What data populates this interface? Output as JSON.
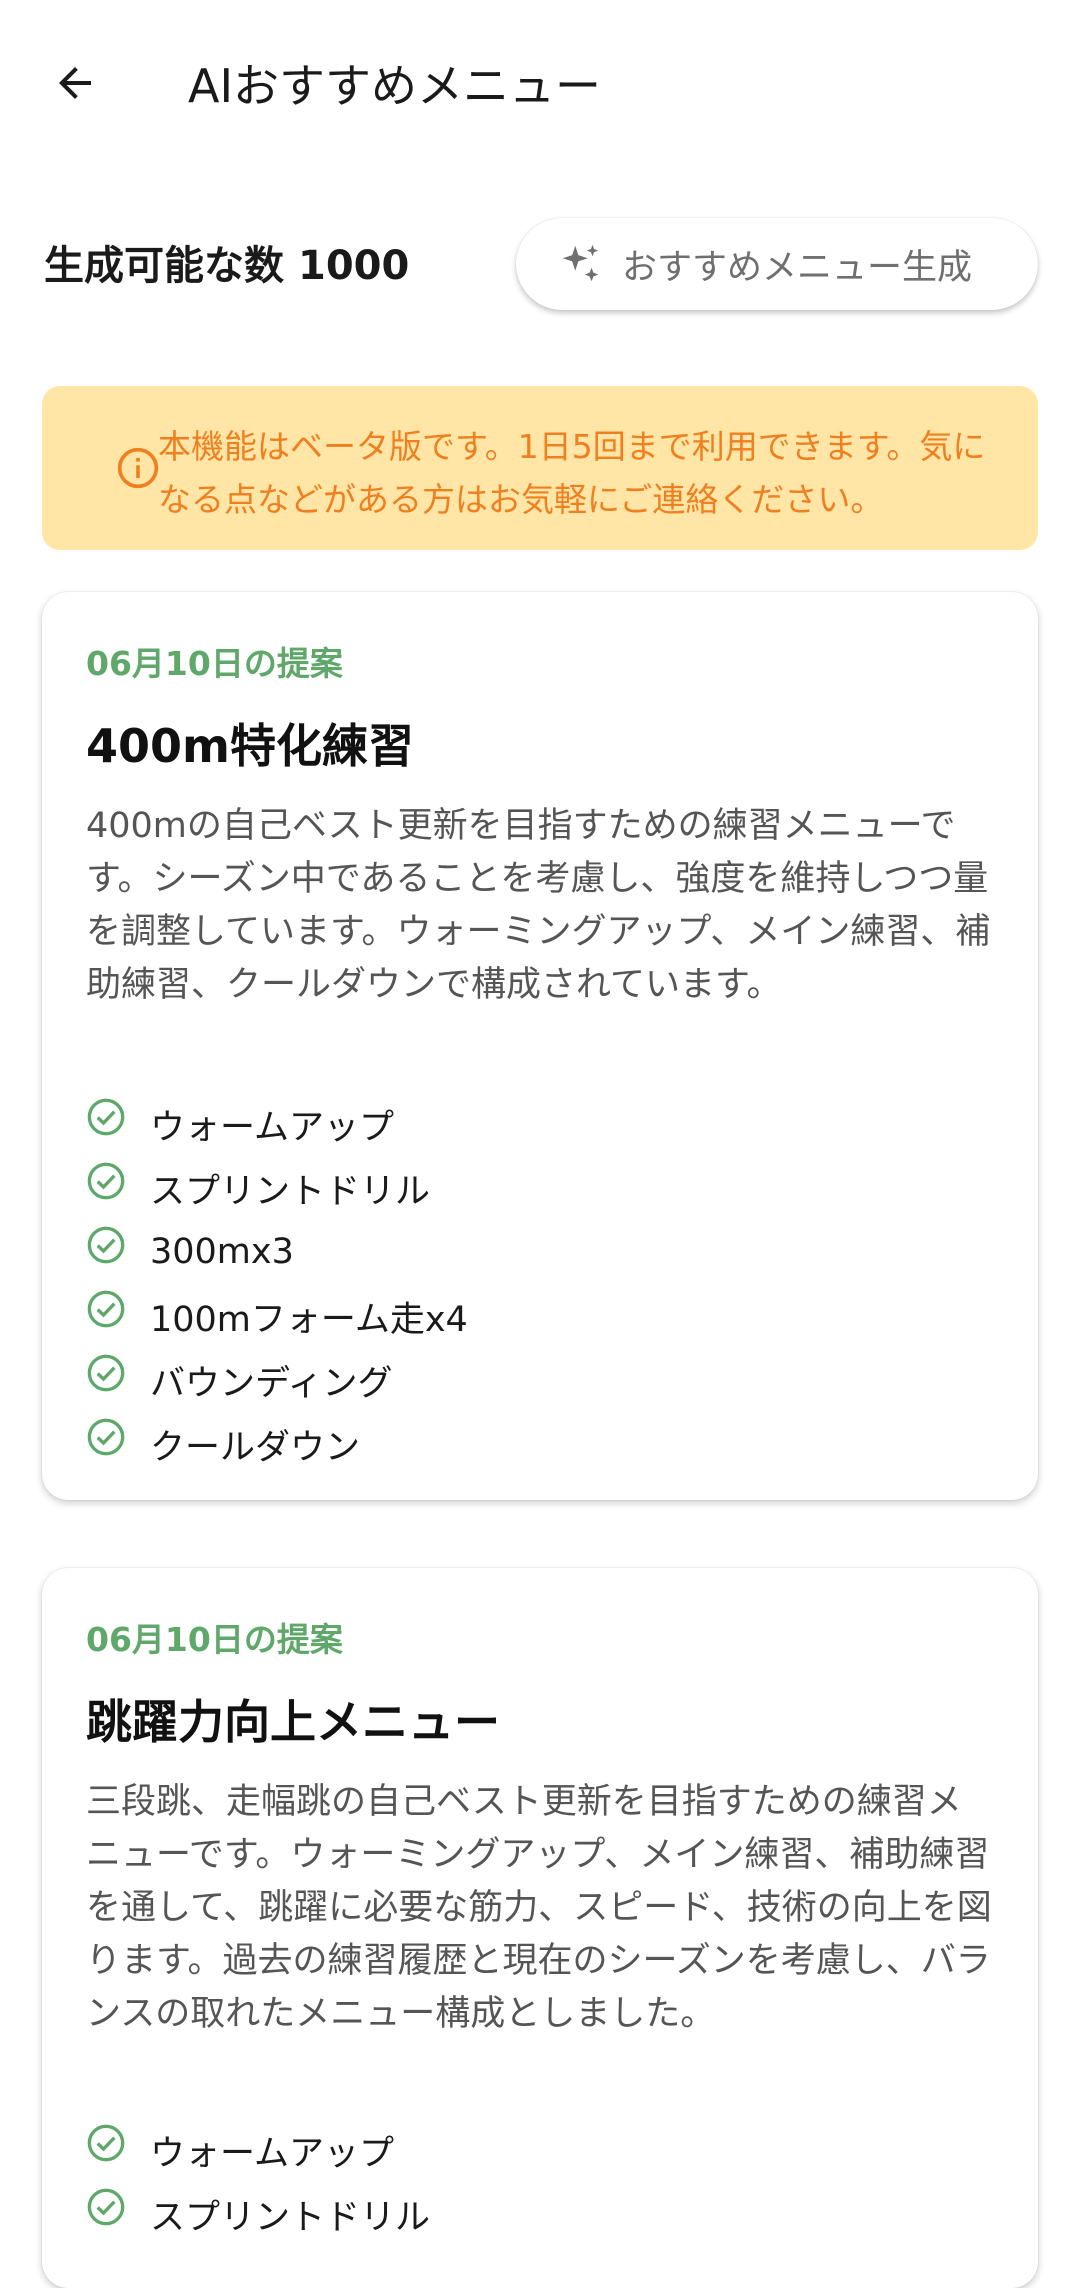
{
  "header": {
    "title": "AIおすすめメニュー",
    "back_icon": "arrow-left-icon"
  },
  "generator": {
    "count_label": "生成可能な数",
    "count_value": "1000",
    "button_label": "おすすめメニュー生成",
    "button_icon": "sparkle-icon"
  },
  "notice": {
    "text": "本機能はベータ版です。1日5回まで利用できます。気になる点などがある方はお気軽にご連絡ください。",
    "icon": "info-icon",
    "background": "#ffe6a6",
    "text_color": "#f07f1f"
  },
  "colors": {
    "accent_green": "#5fa86a"
  },
  "cards": [
    {
      "date": "06月10日の提案",
      "title": "400m特化練習",
      "description": "400mの自己ベスト更新を目指すための練習メニューです。シーズン中であることを考慮し、強度を維持しつつ量を調整しています。ウォーミングアップ、メイン練習、補助練習、クールダウンで構成されています。",
      "items": [
        "ウォームアップ",
        "スプリントドリル",
        "300mx3",
        "100mフォーム走x4",
        "バウンディング",
        "クールダウン"
      ]
    },
    {
      "date": "06月10日の提案",
      "title": "跳躍力向上メニュー",
      "description": "三段跳、走幅跳の自己ベスト更新を目指すための練習メニューです。ウォーミングアップ、メイン練習、補助練習を通して、跳躍に必要な筋力、スピード、技術の向上を図ります。過去の練習履歴と現在のシーズンを考慮し、バランスの取れたメニュー構成としました。",
      "items": [
        "ウォームアップ",
        "スプリントドリル"
      ]
    }
  ]
}
